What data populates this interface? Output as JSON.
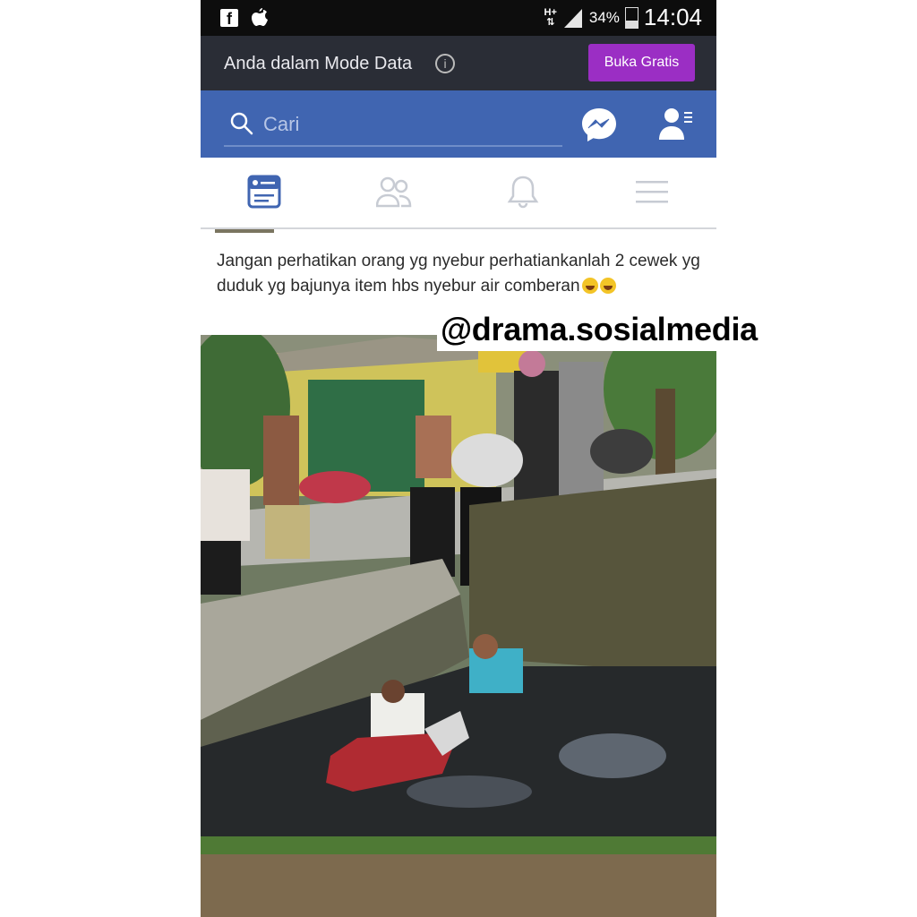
{
  "status_bar": {
    "network": "H+",
    "battery": "34%",
    "time": "14:04"
  },
  "data_banner": {
    "text": "Anda dalam Mode Data",
    "button": "Buka Gratis"
  },
  "search": {
    "placeholder": "Cari"
  },
  "nav_tabs": [
    "news-feed",
    "friend-requests",
    "notifications",
    "menu"
  ],
  "post": {
    "text": "Jangan perhatikan orang yg nyebur perhatiankanlah 2 cewek yg duduk yg bajunya item hbs nyebur air comberan"
  },
  "watermark": "@drama.sosialmedia",
  "colors": {
    "facebook_blue": "#4065b1",
    "banner_dark": "#2a2d36",
    "button_purple": "#9b2ec4",
    "active_tab": "#4065b1",
    "inactive_tab": "#c7cbd3"
  }
}
